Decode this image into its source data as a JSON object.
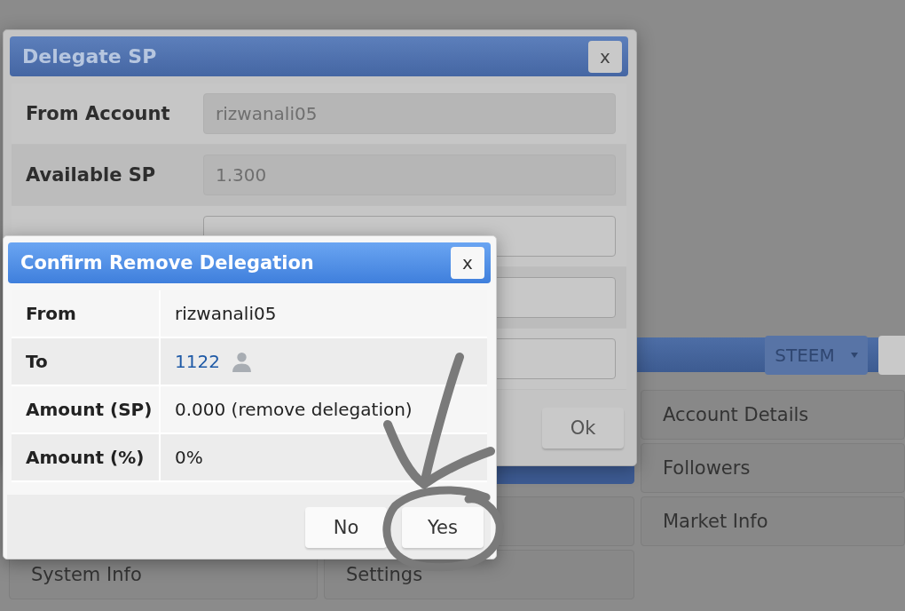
{
  "background_menu": {
    "currency": "STEEM",
    "items": [
      {
        "label": "Account Details",
        "selected": false
      },
      {
        "selected": true
      },
      {
        "label": "Followers",
        "selected": false
      },
      {
        "label": "Market Info",
        "selected": false
      },
      {
        "label": "System Info",
        "selected": false
      },
      {
        "label": "Settings",
        "selected": false
      }
    ]
  },
  "delegate_dialog": {
    "title": "Delegate SP",
    "close": "x",
    "fields": [
      {
        "label": "From Account",
        "value": "rizwanali05",
        "disabled": true
      },
      {
        "label": "Available SP",
        "value": "1.300",
        "disabled": true
      },
      {
        "disabled": false
      },
      {
        "disabled": false
      },
      {
        "disabled": false
      }
    ],
    "buttons": [
      "Ok"
    ]
  },
  "confirm_dialog": {
    "title": "Confirm Remove Delegation",
    "close": "x",
    "rows": [
      {
        "label": "From",
        "value": "rizwanali05",
        "kind": "text"
      },
      {
        "label": "To",
        "value": "1122",
        "kind": "account"
      },
      {
        "label": "Amount (SP)",
        "value": "0.000 (remove delegation)",
        "kind": "text"
      },
      {
        "label": "Amount (%)",
        "value": "0%",
        "kind": "text"
      }
    ],
    "buttons": [
      "No",
      "Yes"
    ]
  }
}
